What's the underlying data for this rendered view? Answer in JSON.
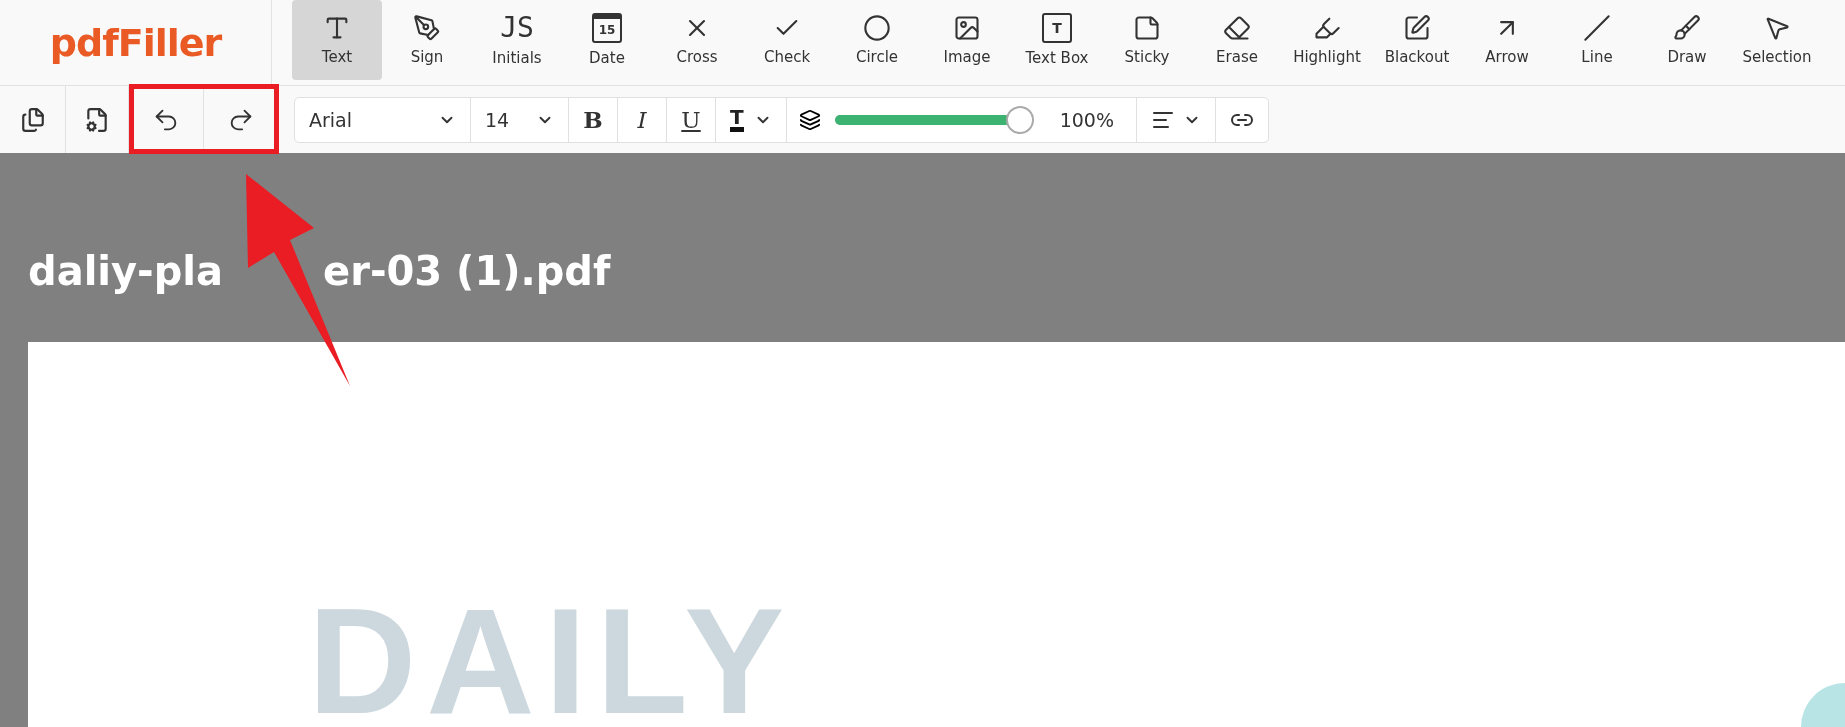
{
  "logo": "pdfFiller",
  "tools": [
    {
      "kind": "text",
      "label": "Text",
      "selected": true
    },
    {
      "kind": "sign",
      "label": "Sign",
      "selected": false
    },
    {
      "kind": "initials",
      "label": "Initials",
      "glyph": "JS",
      "selected": false
    },
    {
      "kind": "date",
      "label": "Date",
      "glyph": "15",
      "selected": false
    },
    {
      "kind": "cross",
      "label": "Cross",
      "selected": false
    },
    {
      "kind": "check",
      "label": "Check",
      "selected": false
    },
    {
      "kind": "circle",
      "label": "Circle",
      "selected": false
    },
    {
      "kind": "image",
      "label": "Image",
      "selected": false
    },
    {
      "kind": "textbox",
      "label": "Text Box",
      "glyph": "T",
      "selected": false
    },
    {
      "kind": "sticky",
      "label": "Sticky",
      "selected": false
    },
    {
      "kind": "erase",
      "label": "Erase",
      "selected": false
    },
    {
      "kind": "highlight",
      "label": "Highlight",
      "selected": false
    },
    {
      "kind": "blackout",
      "label": "Blackout",
      "selected": false
    },
    {
      "kind": "arrow",
      "label": "Arrow",
      "selected": false
    },
    {
      "kind": "line",
      "label": "Line",
      "selected": false
    },
    {
      "kind": "draw",
      "label": "Draw",
      "selected": false
    },
    {
      "kind": "selection",
      "label": "Selection",
      "selected": false
    }
  ],
  "format_bar": {
    "font": "Arial",
    "size": "14",
    "bold": "B",
    "italic": "I",
    "underline": "U",
    "text_color": "T",
    "opacity": {
      "level": 1.0,
      "reading": "100%"
    }
  },
  "document": {
    "title_parts": [
      "daliy-pla",
      "er-03 (1).pdf"
    ],
    "page_heading": "DAILY"
  }
}
